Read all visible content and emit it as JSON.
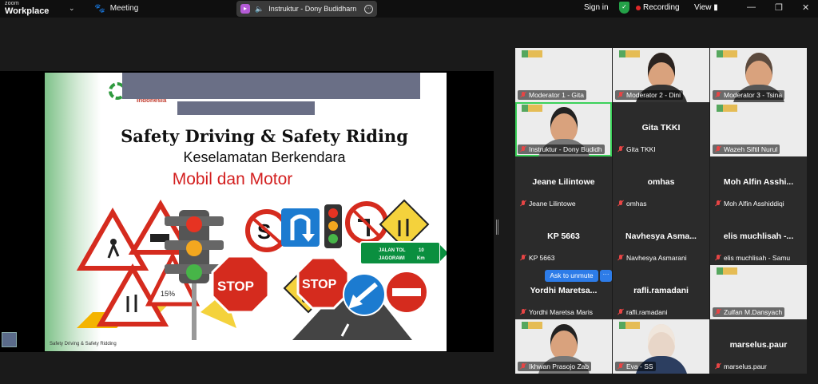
{
  "app": {
    "brand_top": "zoom",
    "brand_bottom": "Workplace"
  },
  "header": {
    "meeting_label": "Meeting",
    "share_label": "Instruktur - Dony Budidharn",
    "sign_in": "Sign in",
    "recording": "Recording",
    "view": "View"
  },
  "slide": {
    "org_text": "Indonesia",
    "title": "Safety Driving & Safety Riding",
    "subtitle": "Keselamatan Berkendara",
    "subtitle2": "Mobil dan Motor",
    "footer": "Safety Driving & Safety Ridding",
    "sign_stop1": "STOP",
    "sign_stop2": "STOP",
    "sign_toll_line1": "JALAN TOL",
    "sign_toll_line2": "JAGORAWI",
    "sign_toll_km1": "10",
    "sign_toll_km2": "Km",
    "sign_percent": "15%"
  },
  "gallery": {
    "ask_to_unmute": "Ask to unmute",
    "ask_more": "···",
    "tiles": [
      {
        "name": "Moderator 1 - Gita",
        "muted": true,
        "video": true
      },
      {
        "name": "Moderator 2 - Dini",
        "muted": true,
        "video": true
      },
      {
        "name": "Moderator 3 - Tsina",
        "muted": true,
        "video": true
      },
      {
        "name": "Instruktur - Dony Budidh",
        "muted": true,
        "video": true,
        "active": true
      },
      {
        "name": "Gita TKKI",
        "center": "Gita TKKI",
        "muted": true,
        "video": false
      },
      {
        "name": "Wazeh Siftil Nurul",
        "muted": true,
        "video": true
      },
      {
        "name": "Jeane Lilintowe",
        "center": "Jeane Lilintowe",
        "muted": true,
        "video": false
      },
      {
        "name": "omhas",
        "center": "omhas",
        "muted": true,
        "video": false
      },
      {
        "name": "Moh Alfin Asshiddiqi",
        "center": "Moh Alfin Asshi...",
        "muted": true,
        "video": false
      },
      {
        "name": "KP 5663",
        "center": "KP 5663",
        "muted": true,
        "video": false
      },
      {
        "name": "Navhesya Asmarani",
        "center": "Navhesya Asma...",
        "muted": true,
        "video": false
      },
      {
        "name": "elis muchlisah - Samu",
        "center": "elis muchlisah -...",
        "muted": true,
        "video": false
      },
      {
        "name": "Yordhi Maretsa Maris",
        "center": "Yordhi Maretsa...",
        "muted": true,
        "video": false
      },
      {
        "name": "rafli.ramadani",
        "center": "rafli.ramadani",
        "muted": true,
        "video": false
      },
      {
        "name": "Zulfan M.Dansyach",
        "muted": true,
        "video": true
      },
      {
        "name": "Ikhwan Prasojo Zab",
        "muted": true,
        "video": true
      },
      {
        "name": "Eva - SS",
        "muted": true,
        "video": true
      },
      {
        "name": "marselus.paur",
        "center": "marselus.paur",
        "muted": true,
        "video": false
      }
    ]
  }
}
